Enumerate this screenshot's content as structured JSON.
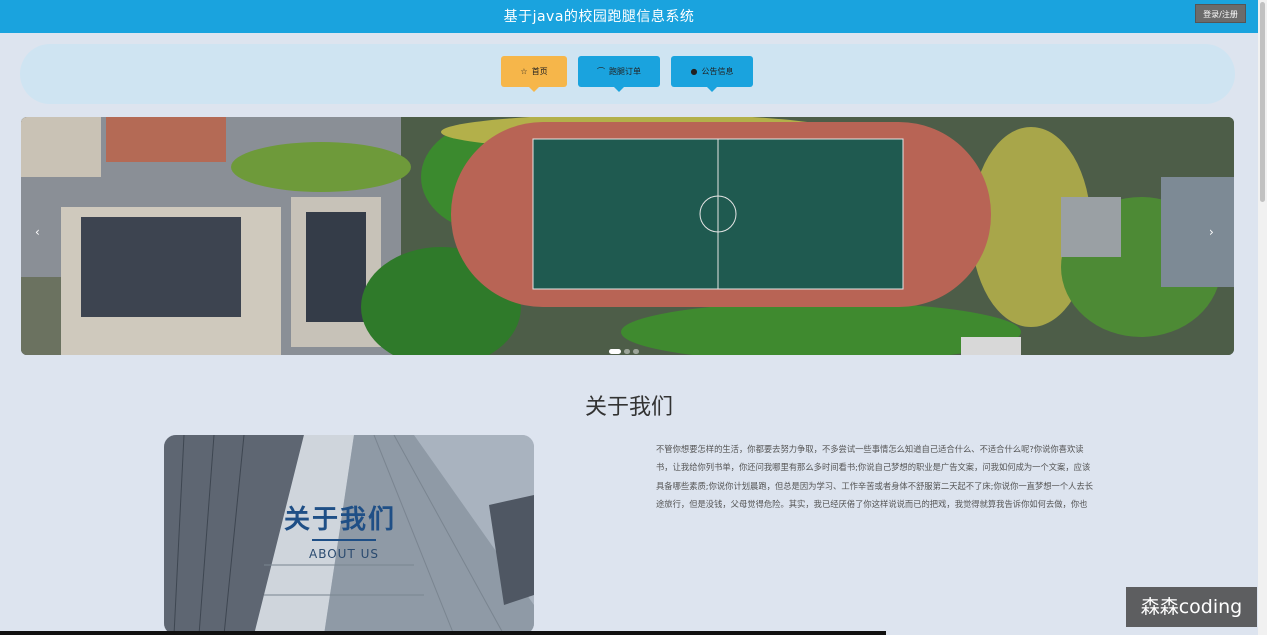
{
  "header": {
    "site_title": "基于java的校园跑腿信息系统",
    "login_label": "登录/注册"
  },
  "nav": {
    "home": {
      "icon": "star-icon",
      "label": "首页"
    },
    "order": {
      "icon": "bell-icon",
      "label": "跑腿订单"
    },
    "notice": {
      "icon": "circle-icon",
      "label": "公告信息"
    }
  },
  "banner": {
    "image": "campus-aerial-photo",
    "slides": 3,
    "active": 1
  },
  "about": {
    "heading": "关于我们",
    "image_title": "关于我们",
    "image_subtitle": "ABOUT US",
    "paragraph": "不管你想要怎样的生活，你都要去努力争取，不多尝试一些事情怎么知道自己适合什么、不适合什么呢?你说你喜欢读书，让我给你列书单，你还问我哪里有那么多时间看书;你说自己梦想的职业是广告文案，问我如何成为一个文案，应该具备哪些素质;你说你计划晨跑，但总是因为学习、工作辛苦或者身体不舒服第二天起不了床;你说你一直梦想一个人去长途旅行，但是没钱，父母觉得危险。其实，我已经厌倦了你这样说说而已的把戏，我觉得就算我告诉你如何去做，你也"
  },
  "watermark": "森森coding",
  "colors": {
    "primary": "#1aa3de",
    "active": "#f6b64a",
    "nav_bg": "#cfe4f2",
    "page_bg": "#dde4ef"
  }
}
